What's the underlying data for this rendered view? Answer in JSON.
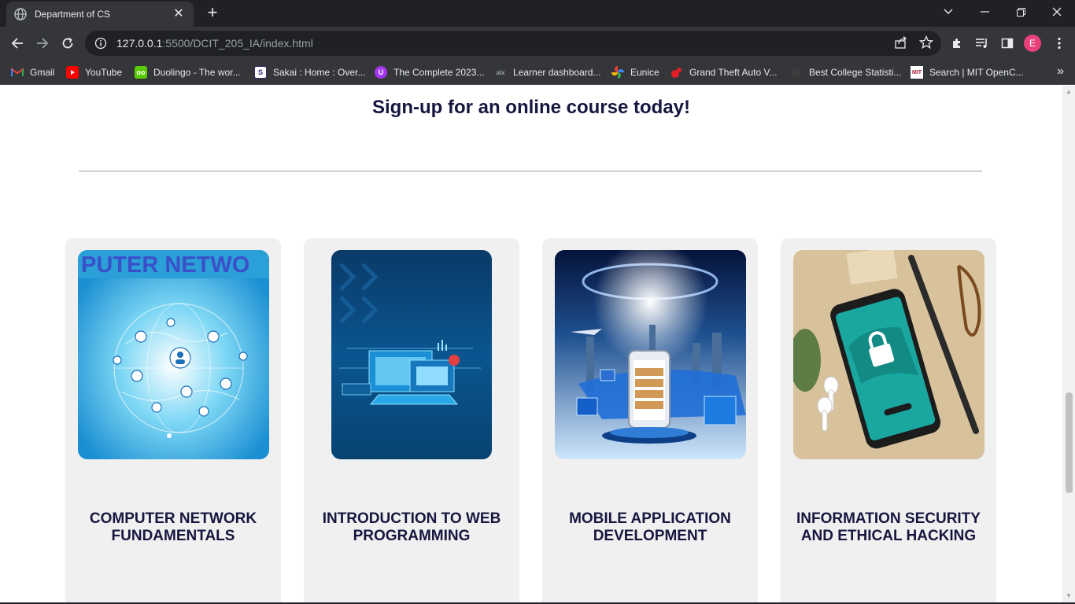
{
  "browser": {
    "tab_title": "Department of CS",
    "url_host": "127.0.0.1",
    "url_path": ":5500/DCIT_205_IA/index.html",
    "profile_initial": "E",
    "bookmarks": [
      {
        "label": "Gmail",
        "icon": "gmail-icon",
        "color": "#ea4335"
      },
      {
        "label": "YouTube",
        "icon": "youtube-icon",
        "color": "#ff0000"
      },
      {
        "label": "Duolingo - The wor...",
        "icon": "duolingo-icon",
        "color": "#58cc02"
      },
      {
        "label": "Sakai : Home : Over...",
        "icon": "sakai-icon",
        "color": "#3b2a78"
      },
      {
        "label": "The Complete 2023...",
        "icon": "udemy-icon",
        "color": "#a435f0"
      },
      {
        "label": "Learner dashboard...",
        "icon": "alx-icon",
        "color": "#3c3c3c"
      },
      {
        "label": "Eunice",
        "icon": "google-photos-icon",
        "color": "#4285f4"
      },
      {
        "label": "Grand Theft Auto V...",
        "icon": "rockstar-icon",
        "color": "#e21e26"
      },
      {
        "label": "Best College Statisti...",
        "icon": "site-icon",
        "color": "#5f6368"
      },
      {
        "label": "Search | MIT OpenC...",
        "icon": "mit-ocw-icon",
        "color": "#a31f34"
      }
    ]
  },
  "page": {
    "heading": "Sign-up for an online course today!",
    "courses": [
      {
        "title": "COMPUTER NETWORK FUNDAMENTALS",
        "image_text": "PUTER NETWO"
      },
      {
        "title": "INTRODUCTION TO WEB PROGRAMMING"
      },
      {
        "title": "MOBILE APPLICATION DEVELOPMENT"
      },
      {
        "title": "INFORMATION SECURITY AND ETHICAL HACKING"
      }
    ]
  },
  "colors": {
    "heading": "#16163f",
    "card_bg": "#f0f0f0",
    "chrome_dark": "#202124",
    "chrome_mid": "#35363a"
  }
}
